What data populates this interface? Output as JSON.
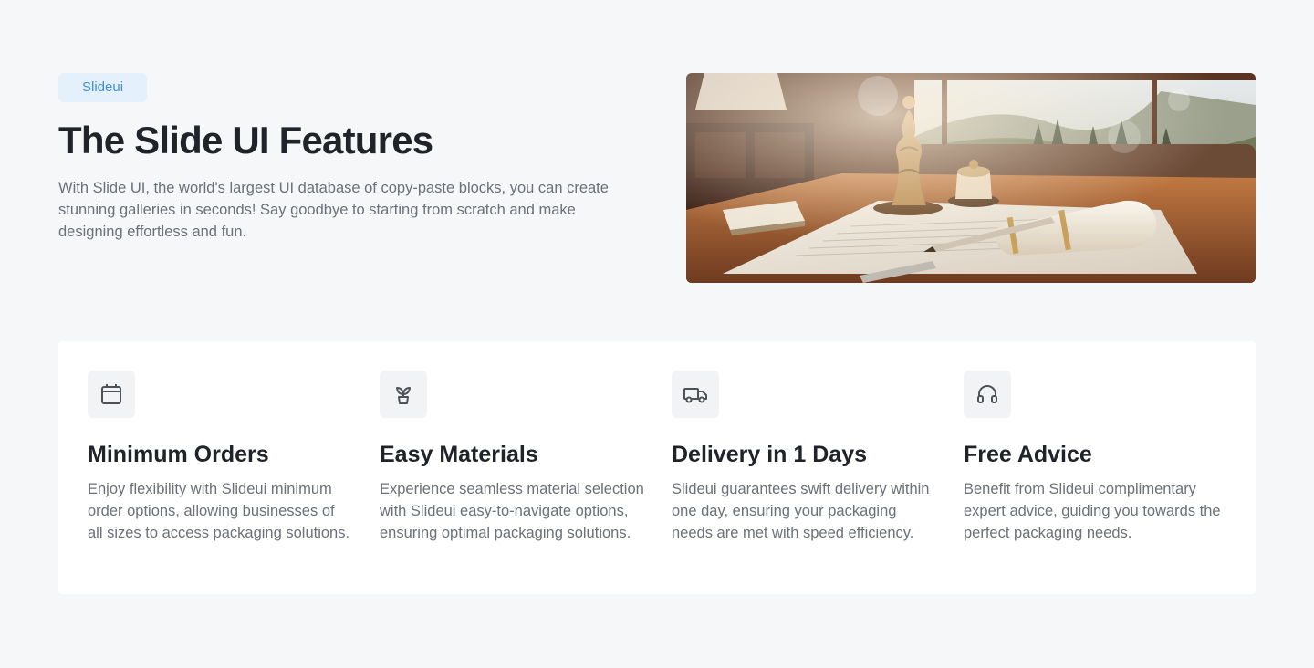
{
  "hero": {
    "badge": "Slideui",
    "title": "The Slide UI Features",
    "description": "With Slide UI, the world's largest UI database of copy-paste blocks, you can create stunning galleries in seconds! Say goodbye to starting from scratch and make designing effortless and fun."
  },
  "features": [
    {
      "icon": "calendar-icon",
      "title": "Minimum Orders",
      "description": "Enjoy flexibility with Slideui minimum order options, allowing businesses of all sizes to access packaging solutions."
    },
    {
      "icon": "plant-icon",
      "title": "Easy Materials",
      "description": "Experience seamless material selection with Slideui easy-to-navigate options, ensuring optimal packaging solutions."
    },
    {
      "icon": "truck-icon",
      "title": "Delivery in 1 Days",
      "description": "Slideui guarantees swift delivery within one day, ensuring your packaging needs are met with speed efficiency."
    },
    {
      "icon": "headphones-icon",
      "title": "Free Advice",
      "description": "Benefit from Slideui complimentary expert advice, guiding you towards the perfect packaging needs."
    }
  ],
  "colors": {
    "background": "#f6f7f9",
    "badge_bg": "#e4f0fb",
    "badge_text": "#3f8fd9",
    "heading": "#20242a",
    "body_text": "#6b7079",
    "card": "#ffffff",
    "icon_bg": "#f2f3f5"
  }
}
